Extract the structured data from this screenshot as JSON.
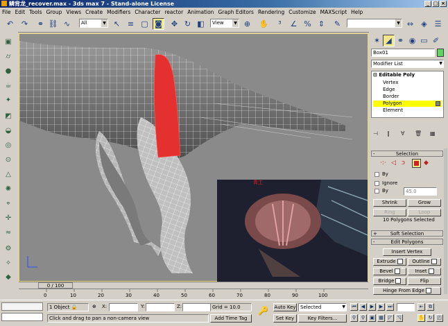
{
  "window": {
    "title": "鳞背龙_recover.max - 3ds max 7   - Stand-alone License"
  },
  "menu": [
    "File",
    "Edit",
    "Tools",
    "Group",
    "Views",
    "Create",
    "Modifiers",
    "Character",
    "reactor",
    "Animation",
    "Graph Editors",
    "Rendering",
    "Customize",
    "MAXScript",
    "Help"
  ],
  "toolbar": {
    "selection_filter": "All",
    "ref_coord": "View"
  },
  "panel": {
    "object_name": "Box01",
    "object_color": "#5cd65c",
    "modifier_list": "Modifier List",
    "stack": {
      "root": "Editable Poly",
      "items": [
        "Vertex",
        "Edge",
        "Border",
        "Polygon",
        "Element"
      ],
      "selected": "Polygon"
    },
    "selection": {
      "title": "Selection",
      "by_vertex": "By",
      "ignore": "Ignore",
      "by_angle": "By",
      "angle_value": "45.0",
      "shrink": "Shrink",
      "grow": "Grow",
      "ring": "Ring",
      "loop": "Loop",
      "status": "10 Polygons Selected"
    },
    "soft_selection": "Soft Selection",
    "edit_polygons": {
      "title": "Edit Polygons",
      "insert_vertex": "Insert Vertex",
      "extrude": "Extrude",
      "outline": "Outline",
      "bevel": "Bevel",
      "inset": "Inset",
      "bridge": "Bridge",
      "flip": "Flip",
      "hinge": "Hinge From Edge"
    },
    "rollout_minus": "-",
    "rollout_plus": "+"
  },
  "timeline": {
    "frame": "0 / 100",
    "ticks": [
      "0",
      "10",
      "20",
      "30",
      "40",
      "50",
      "60",
      "70",
      "80",
      "90",
      "100"
    ]
  },
  "video": {
    "caption": "青工"
  },
  "status": {
    "objects": "1 Object",
    "x_label": "X:",
    "y_label": "Y:",
    "z_label": "Z:",
    "grid": "Grid = 10.0",
    "auto_key": "Auto Key",
    "selected": "Selected",
    "set_key": "Set Key",
    "key_filters": "Key Filters...",
    "prompt": "Click and drag to pan a non-camera view",
    "add_time_tag": "Add Time Tag"
  },
  "colors": {
    "selected_poly": "#e53030",
    "active_viewport_border": "#e8d870",
    "stack_highlight": "#ffff00"
  }
}
